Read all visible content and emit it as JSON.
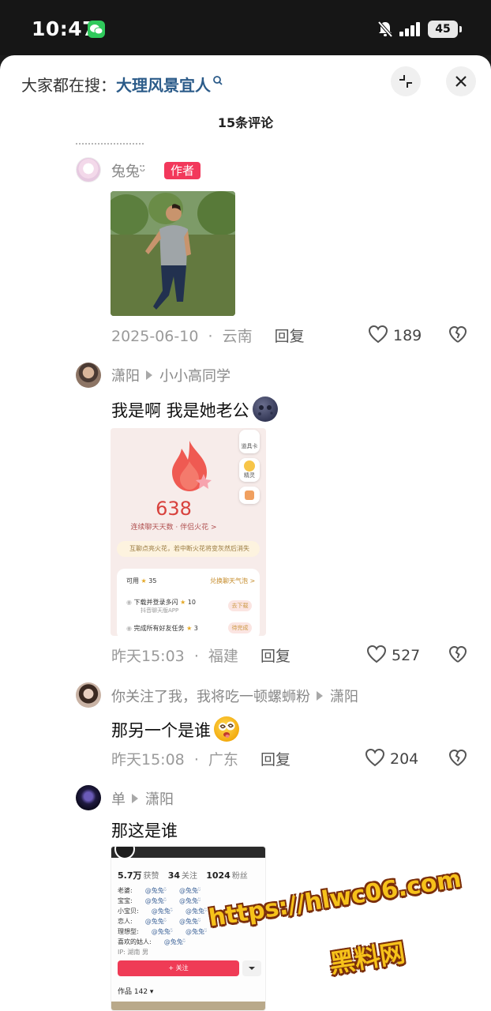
{
  "status_bar": {
    "time": "10:47",
    "battery": "45"
  },
  "header": {
    "search_prefix": "大家都在搜：",
    "search_term": "大理风景宜人",
    "comment_count": "15条评论"
  },
  "comments": [
    {
      "name": "兔兔ᵕ̈",
      "badge": "作者",
      "date": "2025-06-10",
      "sep": "·",
      "region": "云南",
      "reply": "回复",
      "likes": "189"
    },
    {
      "name": "潇阳",
      "reply_to": "小小高同学",
      "text": "我是啊 我是她老公",
      "date": "昨天15:03",
      "sep": "·",
      "region": "福建",
      "reply": "回复",
      "likes": "527"
    },
    {
      "name": "你关注了我，我将吃一顿螺蛳粉",
      "reply_to": "潇阳",
      "text": "那另一个是谁",
      "date": "昨天15:08",
      "sep": "·",
      "region": "广东",
      "reply": "回复",
      "likes": "204"
    },
    {
      "name": "单",
      "reply_to": "潇阳",
      "text": "那这是谁"
    }
  ],
  "screenshot_fire": {
    "number": "638",
    "subtitle": "连续聊天天数 · 伴侣火花 >",
    "tip": "互聊点亮火花，若中断火花将变灰然后消失",
    "available": "可用",
    "available_count": "35",
    "exchange": "兑换聊天气泡 >",
    "task1": "下载并登录多闪",
    "task1_sub": "抖音聊天版APP",
    "task1_reward": "10",
    "task1_btn": "去下载",
    "task2": "完成所有好友任务",
    "task2_reward": "3",
    "task2_btn": "待完成",
    "side1": "道具卡",
    "side2": "精灵"
  },
  "screenshot_profile": {
    "likes_num": "5.7万",
    "likes_label": "获赞",
    "follow_num": "34",
    "follow_label": "关注",
    "fans_num": "1024",
    "fans_label": "粉丝",
    "rows": [
      "老婆:",
      "宝宝:",
      "小宝贝:",
      "恋人:",
      "理想型:",
      "喜欢的姑人:",
      "IP: 湖南  男"
    ],
    "mention": "@兔兔ᵕ̈",
    "follow_btn": "+ 关注",
    "works": "作品 142 ▾"
  },
  "watermark": {
    "url": "https://hlwc06.com",
    "name": "黑料网"
  },
  "colors": {
    "author_badge": "#f2385b",
    "search_term": "#2b5b89",
    "watermark": "#f6c21a"
  }
}
